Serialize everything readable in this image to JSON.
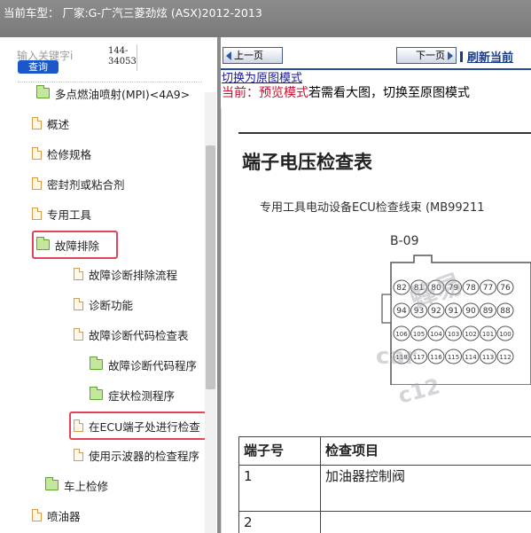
{
  "titlebar": {
    "text": "当前车型：  厂家:G-广汽三菱劲炫 (ASX)2012-2013"
  },
  "sidebar": {
    "search_placeholder": "输入关键字i",
    "search_button": "查询",
    "count": "144-34053",
    "items": [
      {
        "label": "多点燃油喷射(MPI)<4A9>",
        "icon": "folder-open-icon"
      },
      {
        "label": "概述",
        "icon": "document-icon"
      },
      {
        "label": "检修规格",
        "icon": "document-icon"
      },
      {
        "label": "密封剂或粘合剂",
        "icon": "document-icon"
      },
      {
        "label": "专用工具",
        "icon": "document-icon"
      },
      {
        "label": "故障排除",
        "icon": "folder-open-icon"
      },
      {
        "label": "故障诊断排除流程",
        "icon": "document-icon"
      },
      {
        "label": "诊断功能",
        "icon": "document-icon"
      },
      {
        "label": "故障诊断代码检查表",
        "icon": "document-icon"
      },
      {
        "label": "故障诊断代码程序",
        "icon": "folder-open-icon"
      },
      {
        "label": "症状检测程序",
        "icon": "folder-open-icon"
      },
      {
        "label": "在ECU端子处进行检查",
        "icon": "document-icon"
      },
      {
        "label": "使用示波器的检查程序",
        "icon": "document-icon"
      },
      {
        "label": "车上检修",
        "icon": "folder-open-icon"
      },
      {
        "label": "喷油器",
        "icon": "document-icon"
      }
    ]
  },
  "toolbar": {
    "prev": "上一页",
    "next": "下一页",
    "refresh": "刷新当前"
  },
  "content": {
    "switch_link": "切换为原图模式",
    "mode_prefix": "当前：预览模式",
    "mode_suffix": "若需看大图，切换至原图模式",
    "title": "端子电压检查表",
    "subtitle": "专用工具电动设备ECU检查线束 (MB99211",
    "connector_label": "B-09",
    "pins_row1": [
      "82",
      "81",
      "80",
      "79",
      "78",
      "77",
      "76"
    ],
    "pins_row2": [
      "94",
      "93",
      "92",
      "91",
      "90",
      "89",
      "88"
    ],
    "pins_row3": [
      "106",
      "105",
      "104",
      "103",
      "102",
      "101",
      "100"
    ],
    "pins_row4": [
      "118",
      "117",
      "116",
      "115",
      "114",
      "113",
      "112"
    ],
    "watermark1": "蜂易",
    "watermark2": "car",
    "watermark3": "c12"
  },
  "table": {
    "headers": [
      "端子号",
      "检查项目"
    ],
    "rows": [
      [
        "1",
        "加油器控制阀"
      ],
      [
        "2",
        ""
      ]
    ]
  },
  "colors": {
    "accent": "#1a57c9",
    "highlight": "#e0445c",
    "mode_red": "#c8102e"
  }
}
